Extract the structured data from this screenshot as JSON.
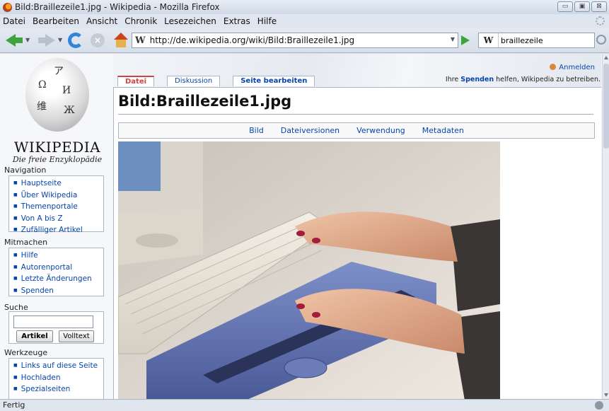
{
  "window": {
    "title": "Bild:Braillezeile1.jpg - Wikipedia - Mozilla Firefox",
    "controls": [
      "▭",
      "▣",
      "⊠"
    ]
  },
  "menu": [
    "Datei",
    "Bearbeiten",
    "Ansicht",
    "Chronik",
    "Lesezeichen",
    "Extras",
    "Hilfe"
  ],
  "navbar": {
    "url": "http://de.wikipedia.org/wiki/Bild:Braillezeile1.jpg",
    "favicon": "W",
    "search_engine": "W",
    "search_value": "braillezeile"
  },
  "sidebar": {
    "wordmark": "WIKIPEDIA",
    "tagline": "Die freie Enzyklopädie",
    "globe_glyphs": [
      "Ω",
      "И",
      "ア",
      "维",
      "Ж"
    ],
    "navigation_title": "Navigation",
    "navigation": [
      "Hauptseite",
      "Über Wikipedia",
      "Themenportale",
      "Von A bis Z",
      "Zufälliger Artikel"
    ],
    "mitmachen_title": "Mitmachen",
    "mitmachen": [
      "Hilfe",
      "Autorenportal",
      "Letzte Änderungen",
      "Spenden"
    ],
    "suche_title": "Suche",
    "suche_btn_article": "Artikel",
    "suche_btn_fulltext": "Volltext",
    "werkzeuge_title": "Werkzeuge",
    "werkzeuge": [
      "Links auf diese Seite",
      "Hochladen",
      "Spezialseiten"
    ]
  },
  "tabs": [
    "Datei",
    "Diskussion",
    "Seite bearbeiten"
  ],
  "user": {
    "login": "Anmelden",
    "donate_pre": "Ihre ",
    "donate_link": "Spenden",
    "donate_post": " helfen, Wikipedia zu betreiben."
  },
  "page": {
    "title": "Bild:Braillezeile1.jpg",
    "filetoc": [
      "Bild",
      "Dateiversionen",
      "Verwendung",
      "Metadaten"
    ]
  },
  "status": {
    "text": "Fertig"
  },
  "colors": {
    "link": "#0645ad",
    "active_tab": "#cc4444",
    "chrome": "#d9e1ea"
  }
}
